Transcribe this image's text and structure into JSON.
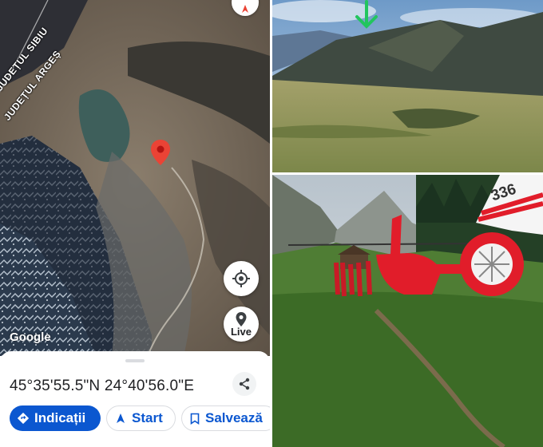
{
  "map": {
    "region_labels": [
      "JUDEȚUL SIBIU",
      "JUDEȚUL ARGEȘ"
    ],
    "watermark": "Google",
    "live_label": "Live",
    "pin_color": "#ea4335"
  },
  "sheet": {
    "coordinates": "45°35'55.5\"N 24°40'56.0\"E",
    "buttons": {
      "directions": "Indicații",
      "start": "Start",
      "save": "Salvează"
    }
  },
  "photos": {
    "landscape_marker_color": "#22c55e",
    "helicopter_tail_number": "336",
    "helicopter_color": "#e11d2a"
  },
  "icons": [
    "compass-icon",
    "pin-icon",
    "my-location-icon",
    "live-view-icon",
    "share-icon",
    "directions-icon",
    "navigation-arrow-icon",
    "bookmark-icon",
    "arrow-down-icon"
  ]
}
